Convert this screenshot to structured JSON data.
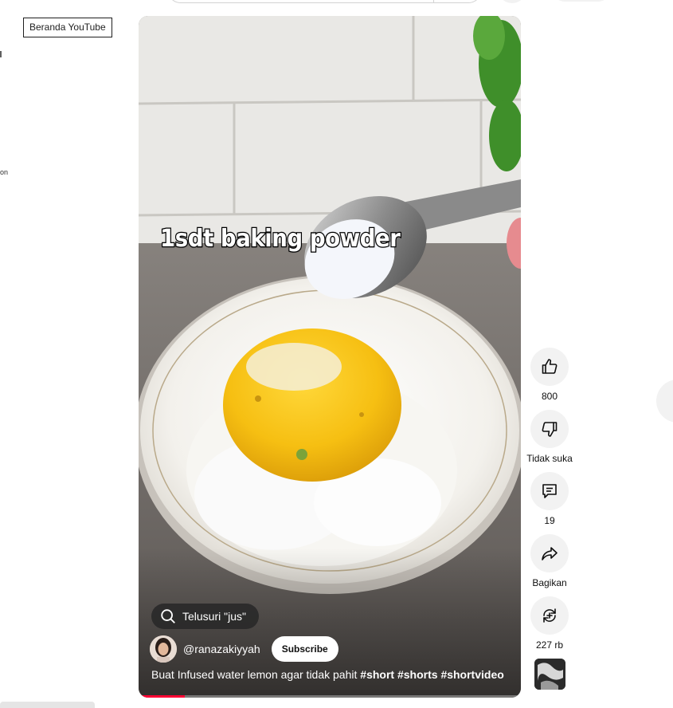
{
  "masthead": {
    "home_tooltip": "Beranda YouTube"
  },
  "sidebar": {
    "fragment_text": "on"
  },
  "short": {
    "overlay_text": "1sdt baking powder",
    "search_chip": "Telusuri \"jus\"",
    "channel": "@ranazakiyyah",
    "subscribe_label": "Subscribe",
    "title_plain": "Buat Infused water lemon agar tidak pahit ",
    "hashtags": [
      "#short",
      "#shorts",
      "#shortvideo"
    ],
    "progress": 0.12,
    "progress_color": "#ff0033"
  },
  "actions": {
    "like_count": "800",
    "dislike_label": "Tidak suka",
    "comment_count": "19",
    "share_label": "Bagikan",
    "remix_count": "227 rb"
  },
  "icons": [
    "thumb-up-icon",
    "thumb-down-icon",
    "comment-icon",
    "share-icon",
    "remix-icon",
    "search-icon"
  ]
}
